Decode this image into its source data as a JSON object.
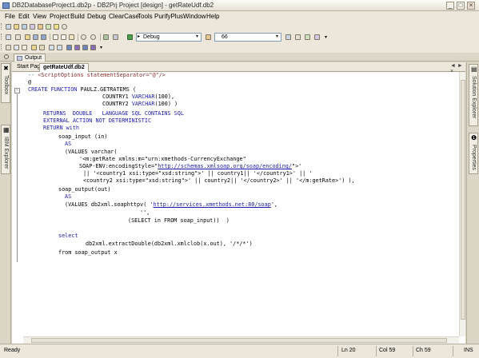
{
  "window": {
    "title": "DB2DatabaseProject1.db2p - DB2Prj Project [design] - getRateUdf.db2"
  },
  "menu": [
    "File",
    "Edit",
    "View",
    "Project",
    "Build",
    "Debug",
    "ClearCase",
    "Tools",
    "PurifyPlus",
    "Window",
    "Help"
  ],
  "toolbar": {
    "config_combo": "Debug",
    "find_combo": "66"
  },
  "output_tab": {
    "label": "Output"
  },
  "left_dock": {
    "toolbox": "Toolbox",
    "ibm_explorer": "IBM Explorer"
  },
  "right_dock": {
    "solution_explorer": "Solution Explorer",
    "properties": "Properties"
  },
  "doc_tabs": {
    "start_page": "Start Page",
    "active": "getRateUdf.db2",
    "nav": "◄ ► ×"
  },
  "code": {
    "l01a": "-- ",
    "l01b": "<ScriptOptions statementSeparator=\"@\"/>",
    "l02": "@",
    "l03a": "CREATE FUNCTION",
    "l03b": " PAULZ.GETRATEMS (",
    "l04a": "COUNTRY1 ",
    "l04b": "VARCHAR",
    "l04c": "(100),",
    "l05a": "COUNTRY2 ",
    "l05b": "VARCHAR",
    "l05c": "(100) )",
    "l06a": "RETURNS  DOUBLE   LANGUAGE SQL CONTAINS SQL",
    "l07a": "EXTERNAL ACTION NOT DETERMINISTIC",
    "l08a": "RETURN with",
    "l09a": "soap_input (in)",
    "l10a": "AS",
    "l11a": "(VALUES varchar(",
    "l12a": "'<m:getRate xmlns:m=\"urn:xmethods-CurrencyExchange\"",
    "l13a": "SOAP-ENV:encodingStyle=\"",
    "l13b": "http://schemas.xmlsoap.org/soap/encoding/",
    "l13c": "\">'",
    "l14a": "|| '<country1 xsi:type=\"xsd:string\">' || country1|| '</country1>' || '",
    "l15a": "<country2 xsi:type=\"xsd:string\">' || country2|| '</country2>' || '</m:getRate>') ),",
    "l16a": "soap_output(out)",
    "l17a": "AS",
    "l18a": "(VALUES db2xml.soaphttpv( '",
    "l18b": "http://services.xmethods.net:80/soap",
    "l18c": "',",
    "l19a": "'',",
    "l20a": "(SELECT in FROM soap_input))  )",
    "l21a": "select",
    "l22a": "db2xml.extractDouble(db2xml.xmlclob(x.out), '/*/*')",
    "l23a": "from soap_output x"
  },
  "status": {
    "ready": "Ready",
    "ln": "Ln 20",
    "col": "Col 59",
    "ch": "Ch 59",
    "ins": "INS"
  }
}
